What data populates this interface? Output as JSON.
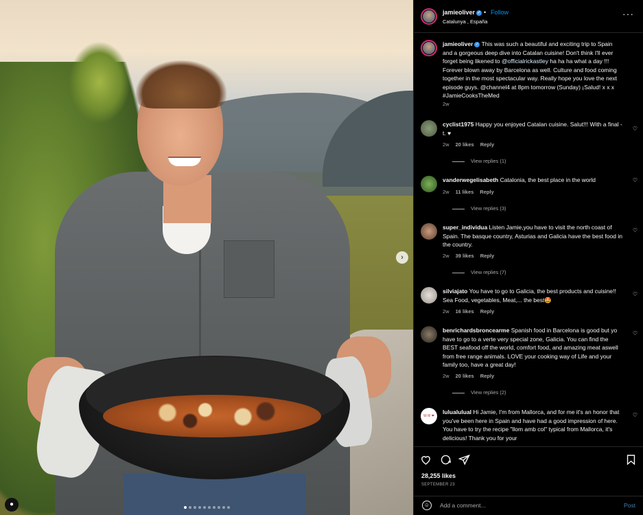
{
  "post": {
    "header": {
      "username": "jamieoliver",
      "separator": "•",
      "follow_label": "Follow",
      "location": "Catalunya , España",
      "more_icon": "more-horizontal-icon"
    },
    "caption": {
      "username": "jamieoliver",
      "text_a": " This was such a beautiful and exciting trip to Spain and a gorgeous deep dive into Catalan cuisine! Don't think I'll ever forget being likened to ",
      "mention": "@officialrickastley",
      "text_b": " ha ha ha what a day !!! Forever blown away by Barcelona as well. Culture and food coming together in the most spectacular way. Really hope you love the next episode guys. @channel4 at 8pm tomorrow (Sunday) ¡Salud! x x x #JamieCooksTheMed",
      "time": "2w"
    },
    "comments": [
      {
        "username": "cyclist1975",
        "text": " Happy you enjoyed Catalan cuisine. Salut!!! With a final - t. ♥",
        "time": "2w",
        "likes": "20 likes",
        "reply": "Reply",
        "view_replies": "View replies (1)"
      },
      {
        "username": "vanderwegelisabeth",
        "text": " Catalonia, the best place in the world",
        "time": "2w",
        "likes": "11 likes",
        "reply": "Reply",
        "view_replies": "View replies (3)"
      },
      {
        "username": "super_individua",
        "text": " Listen Jamie,you have to visit the north coast of Spain. The basque country, Asturias and Galicia have the best food in the country.",
        "time": "2w",
        "likes": "39 likes",
        "reply": "Reply",
        "view_replies": "View replies (7)"
      },
      {
        "username": "silviajato",
        "text": " You have to go to Galicia, the best products and cuisine!! Sea Food, vegetables, Meat,... the best🤩",
        "time": "2w",
        "likes": "16 likes",
        "reply": "Reply",
        "view_replies": ""
      },
      {
        "username": "benrichardsbroncearme",
        "text": " Spanish food in Barcelona is good but yo have to go to a verte very special zone, Galicia. You can find the BEST seafood off the world, comfort food, and amazing meat aswell from free range animals. LOVE your cooking way of Life and your family too, have a great day!",
        "time": "2w",
        "likes": "20 likes",
        "reply": "Reply",
        "view_replies": "View replies (2)"
      },
      {
        "username": "lulualulual",
        "text": " Hi Jamie, I'm from Mallorca, and for me it's an honor that you've been here in Spain and have had a good impression of here. You have to try the recipe \"llom amb col\" typical from Mallorca, it's delicious! Thank you for your",
        "time": "",
        "likes": "",
        "reply": "",
        "view_replies": "",
        "avatar_text": "W M ❤"
      }
    ],
    "actions": {
      "like_icon": "heart-icon",
      "comment_icon": "comment-icon",
      "share_icon": "paper-plane-icon",
      "save_icon": "bookmark-icon"
    },
    "likes": "28,255 likes",
    "date": "SEPTEMBER 23",
    "add_comment": {
      "placeholder": "Add a comment...",
      "post_label": "Post"
    },
    "media": {
      "carousel_count": 10,
      "active_index": 0
    }
  }
}
